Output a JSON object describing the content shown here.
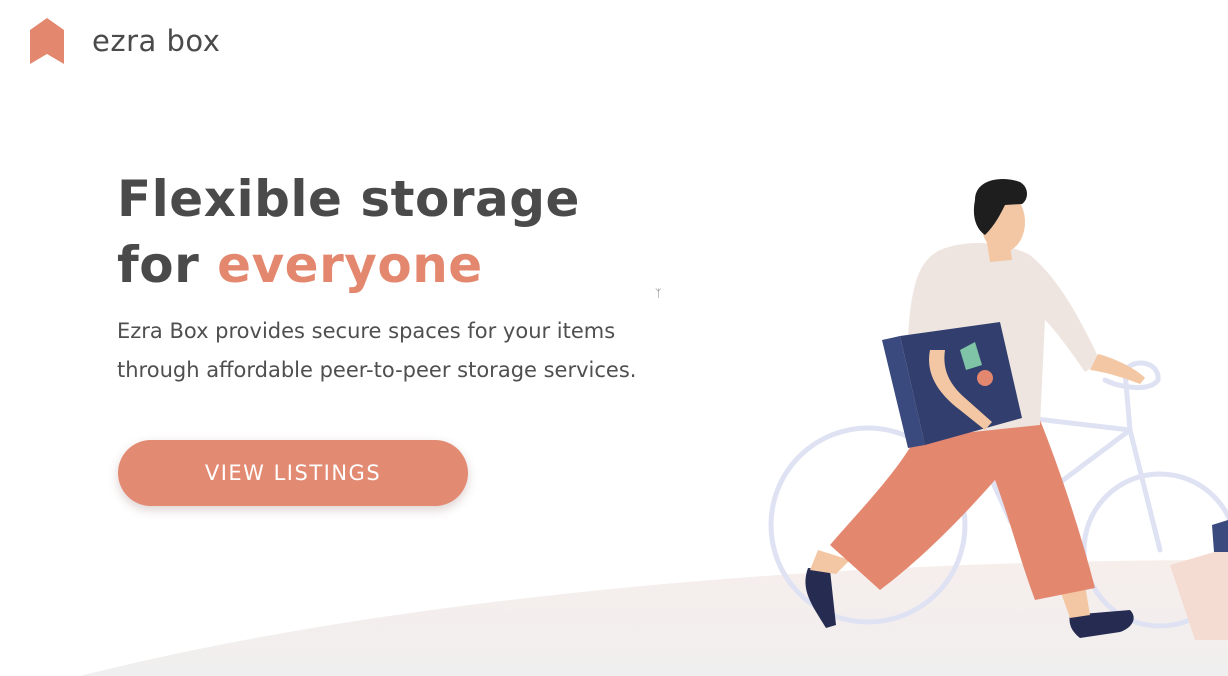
{
  "brand": {
    "name": "ezra box",
    "logo_icon": "bookmark-house-icon",
    "accent_color": "#e4876f"
  },
  "hero": {
    "title_line1": "Flexible storage",
    "title_line2_prefix": "for ",
    "title_line2_accent": "everyone",
    "description": "Ezra Box provides secure spaces for your items through affordable peer-to-peer storage services.",
    "cta_label": "VIEW LISTINGS"
  },
  "illustration": {
    "subject": "person-carrying-box-with-bicycle-illustration"
  },
  "colors": {
    "text": "#4a4a4a",
    "button": "#e38a73",
    "shirt": "#eee5e0",
    "pants": "#e4876f",
    "box": "#3b4a7e",
    "bicycle": "#dde1f2"
  }
}
